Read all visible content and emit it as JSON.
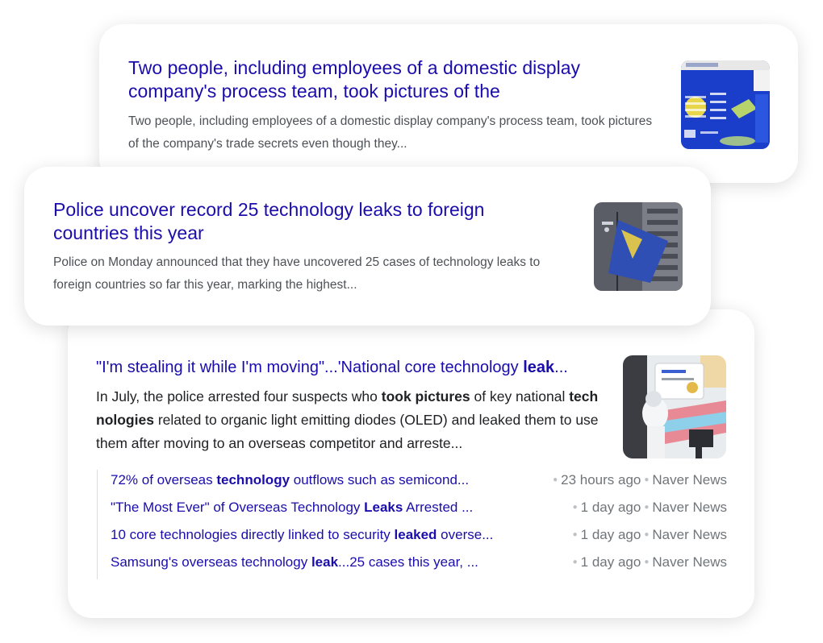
{
  "cards": [
    {
      "title": "Two people, including employees of a domestic display company's process team, took pictures of the",
      "snippet": "Two people, including employees of a domestic display company's process team, took pictures of the company's trade secrets even though they..."
    },
    {
      "title": "Police uncover record 25 technology leaks to foreign countries this year",
      "snippet": "Police on Monday announced that they have uncovered 25 cases of technology leaks to foreign countries so far this year, marking the highest..."
    }
  ],
  "featured": {
    "title_pre": "\"I'm stealing it while I'm moving\"...'National core technology ",
    "title_bold": "leak",
    "title_post": "...",
    "snippet_1": "In July, the police arrested four suspects who ",
    "snippet_b1": "took pictures",
    "snippet_2": " of key national ",
    "snippet_b2": "technologies",
    "snippet_3": " related to organic light emitting diodes (OLED) and leaked them to use them after moving to an overseas competitor and arreste...",
    "related": [
      {
        "pre": "72% of overseas ",
        "bold": "technology",
        "post": " outflows such as semicond...",
        "time": "23 hours ago",
        "source": "Naver News"
      },
      {
        "pre": "\"The Most Ever\" of Overseas Technology ",
        "bold": "Leaks",
        "post": " Arrested ...",
        "time": "1 day ago",
        "source": "Naver News"
      },
      {
        "pre": "10 core technologies directly linked to security ",
        "bold": "leaked",
        "post": " overse...",
        "time": "1 day ago",
        "source": "Naver News"
      },
      {
        "pre": "Samsung's overseas technology ",
        "bold": "leak",
        "post": "...25 cases this year, ...",
        "time": "1 day ago",
        "source": "Naver News"
      }
    ]
  },
  "colors": {
    "link": "#1a0dab",
    "snippet": "#4d5156",
    "meta": "#70757a"
  },
  "icons": {
    "separator": "dot-separator-icon"
  }
}
